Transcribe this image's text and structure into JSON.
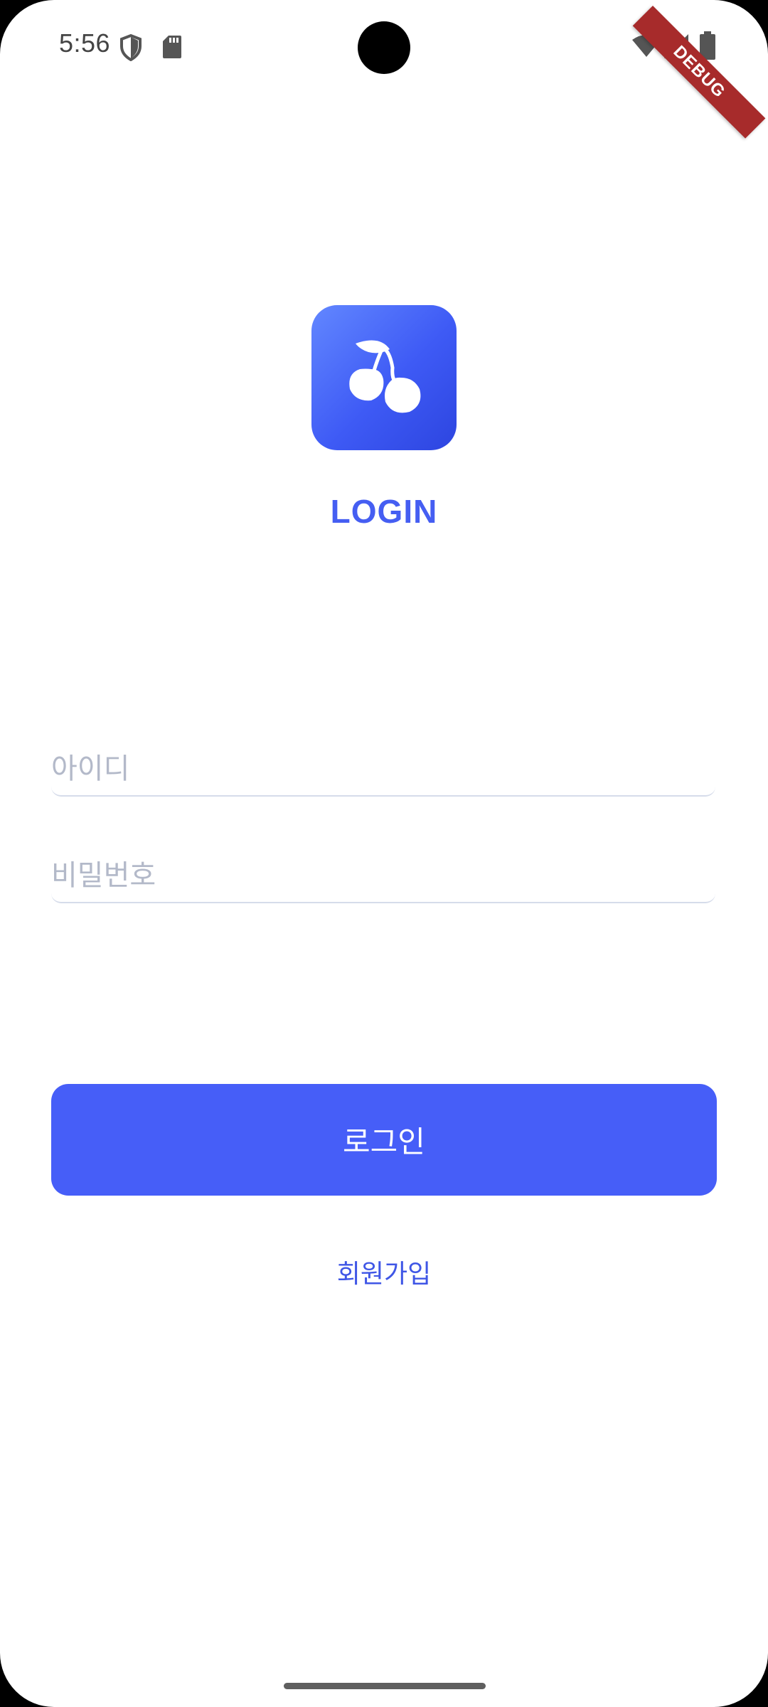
{
  "status_bar": {
    "time": "5:56",
    "icons": [
      "shield-icon",
      "sd-card-icon",
      "wifi-icon",
      "cellular-signal-icon",
      "battery-icon"
    ]
  },
  "debug_banner": {
    "label": "DEBUG",
    "color": "#a72b2b"
  },
  "logo": {
    "icon": "cherry-icon",
    "gradient": [
      "#6287ff",
      "#2d45e0"
    ]
  },
  "title": "LOGIN",
  "form": {
    "id_placeholder": "아이디",
    "id_value": "",
    "password_placeholder": "비밀번호",
    "password_value": ""
  },
  "login_button": {
    "label": "로그인"
  },
  "signup_link": {
    "label": "회원가입"
  },
  "colors": {
    "accent": "#465ef8",
    "title": "#455ef2",
    "placeholder": "#b3b9c9",
    "underline": "#d6dcea"
  }
}
